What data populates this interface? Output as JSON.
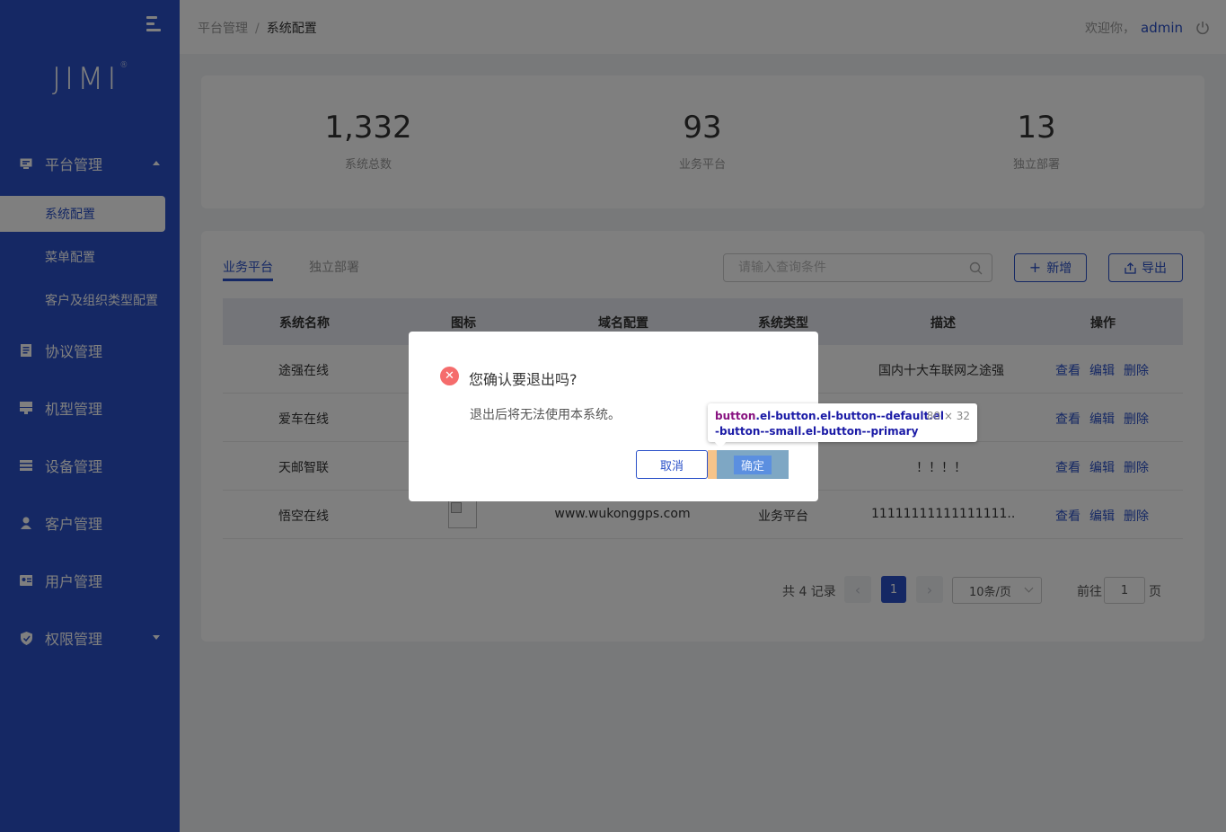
{
  "sidebar": {
    "logo_text": "JIMI",
    "logo_mark": "®",
    "menu": [
      {
        "label": "平台管理",
        "icon": "monitor-icon"
      },
      {
        "label": "协议管理",
        "icon": "document-icon"
      },
      {
        "label": "机型管理",
        "icon": "server-icon"
      },
      {
        "label": "设备管理",
        "icon": "device-icon"
      },
      {
        "label": "客户管理",
        "icon": "person-icon"
      },
      {
        "label": "用户管理",
        "icon": "id-card-icon"
      },
      {
        "label": "权限管理",
        "icon": "shield-icon"
      }
    ],
    "submenu": [
      {
        "label": "系统配置"
      },
      {
        "label": "菜单配置"
      },
      {
        "label": "客户及组织类型配置"
      }
    ]
  },
  "header": {
    "breadcrumb": [
      "平台管理",
      "系统配置"
    ],
    "separator": "/",
    "welcome": "欢迎你，",
    "username": "admin"
  },
  "stats": [
    {
      "value": "1,332",
      "label": "系统总数"
    },
    {
      "value": "93",
      "label": "业务平台"
    },
    {
      "value": "13",
      "label": "独立部署"
    }
  ],
  "tabs": [
    {
      "label": "业务平台"
    },
    {
      "label": "独立部署"
    }
  ],
  "search": {
    "placeholder": "请输入查询条件",
    "value": ""
  },
  "toolbar": {
    "add_label": "新增",
    "add_icon": "+",
    "export_label": "导出"
  },
  "table": {
    "columns": [
      "系统名称",
      "图标",
      "域名配置",
      "系统类型",
      "描述",
      "操作"
    ],
    "rows": [
      {
        "name": "途强在线",
        "domain": "",
        "type": "",
        "desc": "国内十大车联网之途强"
      },
      {
        "name": "爱车在线",
        "domain": "",
        "type": "",
        "desc": ""
      },
      {
        "name": "天邮智联",
        "domain": "",
        "type": "",
        "desc": "！！！！"
      },
      {
        "name": "悟空在线",
        "domain": "www.wukonggps.com",
        "type": "业务平台",
        "desc": "11111111111111111..."
      }
    ],
    "ops": [
      "查看",
      "编辑",
      "删除"
    ]
  },
  "pagination": {
    "total_text": "共 4 记录",
    "current_page": "1",
    "page_size": "10条/页",
    "goto_label": "前往",
    "goto_value": "1",
    "page_suffix": "页",
    "prev": "‹",
    "next": "›"
  },
  "dialog": {
    "title": "您确认要退出吗?",
    "message": "退出后将无法使用本系统。",
    "cancel_label": "取消",
    "confirm_label": "确定",
    "icon": "✕"
  },
  "devtools_tooltip": {
    "tag": "button",
    "classes_line1": ".el-button.el-button--default.el",
    "classes_line2": "-button--small.el-button--primary",
    "dims": "80 × 32"
  },
  "colors": {
    "sidebar": "#2a50c8",
    "accent": "#2a50c8",
    "danger": "#f56c6c"
  }
}
